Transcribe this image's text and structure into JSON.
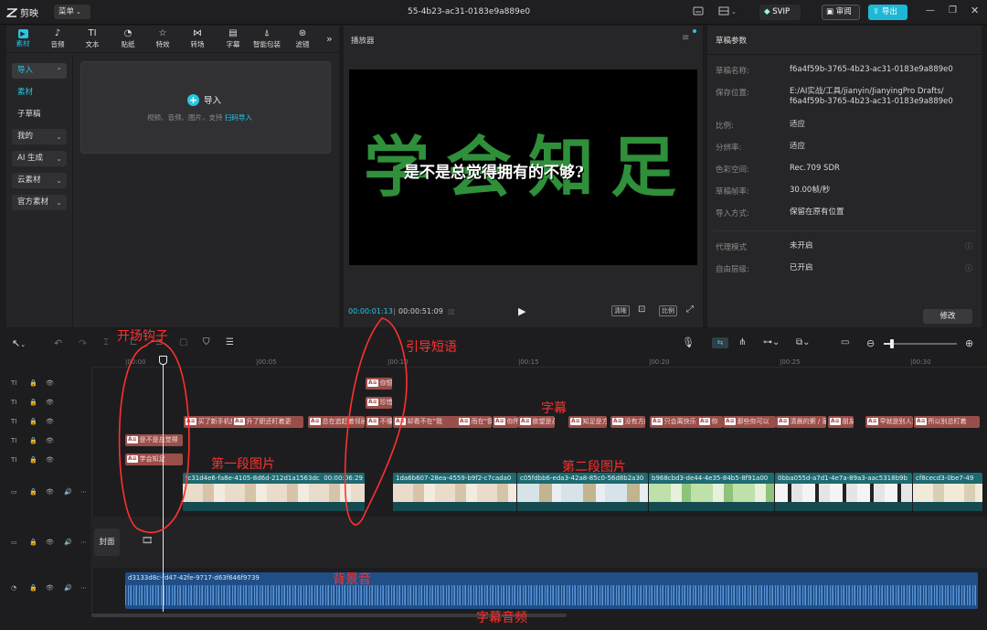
{
  "app": {
    "name": "剪映",
    "menu_label": "菜单",
    "title": "55-4b23-ac31-0183e9a889e0"
  },
  "titlebar": {
    "svip": "SVIP",
    "review": "审阅",
    "export": "导出"
  },
  "tools": [
    {
      "label": "素材",
      "icon": "media-icon"
    },
    {
      "label": "音频",
      "icon": "audio-icon"
    },
    {
      "label": "文本",
      "icon": "text-icon"
    },
    {
      "label": "贴纸",
      "icon": "sticker-icon"
    },
    {
      "label": "特效",
      "icon": "effects-icon"
    },
    {
      "label": "转场",
      "icon": "transition-icon"
    },
    {
      "label": "字幕",
      "icon": "caption-icon"
    },
    {
      "label": "智能包装",
      "icon": "smart-pack-icon"
    },
    {
      "label": "滤镜",
      "icon": "filter-icon"
    }
  ],
  "left_menu": {
    "import": "导入",
    "material": "素材",
    "sub_draft": "子草稿",
    "mine": "我的",
    "ai": "AI 生成",
    "cloud": "云素材",
    "official": "官方素材"
  },
  "import_box": {
    "title": "导入",
    "hint": "视频、音频、图片，支持",
    "hint_link": "扫码导入"
  },
  "player": {
    "title": "播放器",
    "overlay_big": "学会知足",
    "overlay_small": "是不是总觉得拥有的不够?",
    "time_current": "00:00:01:13",
    "time_total": "00:00:51:09",
    "quality": "清晰",
    "ratio": "比例"
  },
  "draft": {
    "title": "草稿参数",
    "props": [
      {
        "k": "草稿名称:",
        "v": "f6a4f59b-3765-4b23-ac31-0183e9a889e0"
      },
      {
        "k": "保存位置:",
        "v": "E:/AI实战/工具/jianyin/JianyingPro Drafts/",
        "v2": "f6a4f59b-3765-4b23-ac31-0183e9a889e0"
      },
      {
        "k": "比例:",
        "v": "适应"
      },
      {
        "k": "分辨率:",
        "v": "适应"
      },
      {
        "k": "色彩空间:",
        "v": "Rec.709 SDR"
      },
      {
        "k": "草稿帧率:",
        "v": "30.00帧/秒"
      },
      {
        "k": "导入方式:",
        "v": "保留在原有位置"
      },
      {
        "k": "代理模式",
        "v": "未开启"
      },
      {
        "k": "自由层级:",
        "v": "已开启"
      }
    ],
    "modify": "修改"
  },
  "ruler": [
    "|00:00",
    "|00:05",
    "|00:10",
    "|00:15",
    "|00:20",
    "|00:25",
    "|00:30"
  ],
  "tracks": {
    "text1": [
      {
        "t": "你惯"
      }
    ],
    "text2": [
      {
        "t": "珍惜"
      }
    ],
    "text3": [
      {
        "t": "买了新手机想要"
      },
      {
        "t": "升了职还盯着更"
      },
      {
        "t": "总在追赶着邻居"
      },
      {
        "t": "不懂"
      },
      {
        "t": "却看不在\"我"
      },
      {
        "t": "而在\"我已"
      },
      {
        "t": "你所"
      },
      {
        "t": "欲望是永"
      },
      {
        "t": "知足是方"
      },
      {
        "t": "没有方向"
      },
      {
        "t": "只会离快乐"
      },
      {
        "t": "你"
      },
      {
        "t": "那些你可以"
      },
      {
        "t": "清晨的粥 / 家"
      },
      {
        "t": "朋友"
      },
      {
        "t": "早就是别人求"
      },
      {
        "t": "所以别总盯着"
      }
    ],
    "text4": [
      {
        "t": "是不是总觉得"
      }
    ],
    "text5": [
      {
        "t": "学会知足"
      }
    ],
    "video1": [
      {
        "t": "fc31d4e6-fa8e-4105-8d6d-212d1a1563dc",
        "d": "00:00:06:29"
      },
      {
        "t": "1da6b607-28ea-4559-b9f2-c7cada0"
      },
      {
        "t": "c05fdbb6-eda3-42a8-85c0-56d8b2a30"
      },
      {
        "t": "b968cbd3-de44-4e35-84b5-8f91a00"
      },
      {
        "t": "0bba055d-a7d1-4e7a-89a3-aac5318b9b"
      },
      {
        "t": "cf8cecd3-0be7-49"
      }
    ],
    "cover": "封面",
    "audio": {
      "t": "d3133d8c-fd47-42fe-9717-d63f646f9739"
    }
  },
  "annotations": {
    "hook": "开场钩子",
    "guide": "引导短语",
    "caption": "字幕",
    "img1": "第一段图片",
    "img2": "第二段图片",
    "bgm": "背景音",
    "caption_audio": "字幕音频"
  },
  "colors": {
    "accent": "#27c5e3",
    "text_clip": "#9a4e4a",
    "video_clip": "#1e6a71",
    "audio_clip": "#1f4f86",
    "annotation": "#ff3030"
  }
}
